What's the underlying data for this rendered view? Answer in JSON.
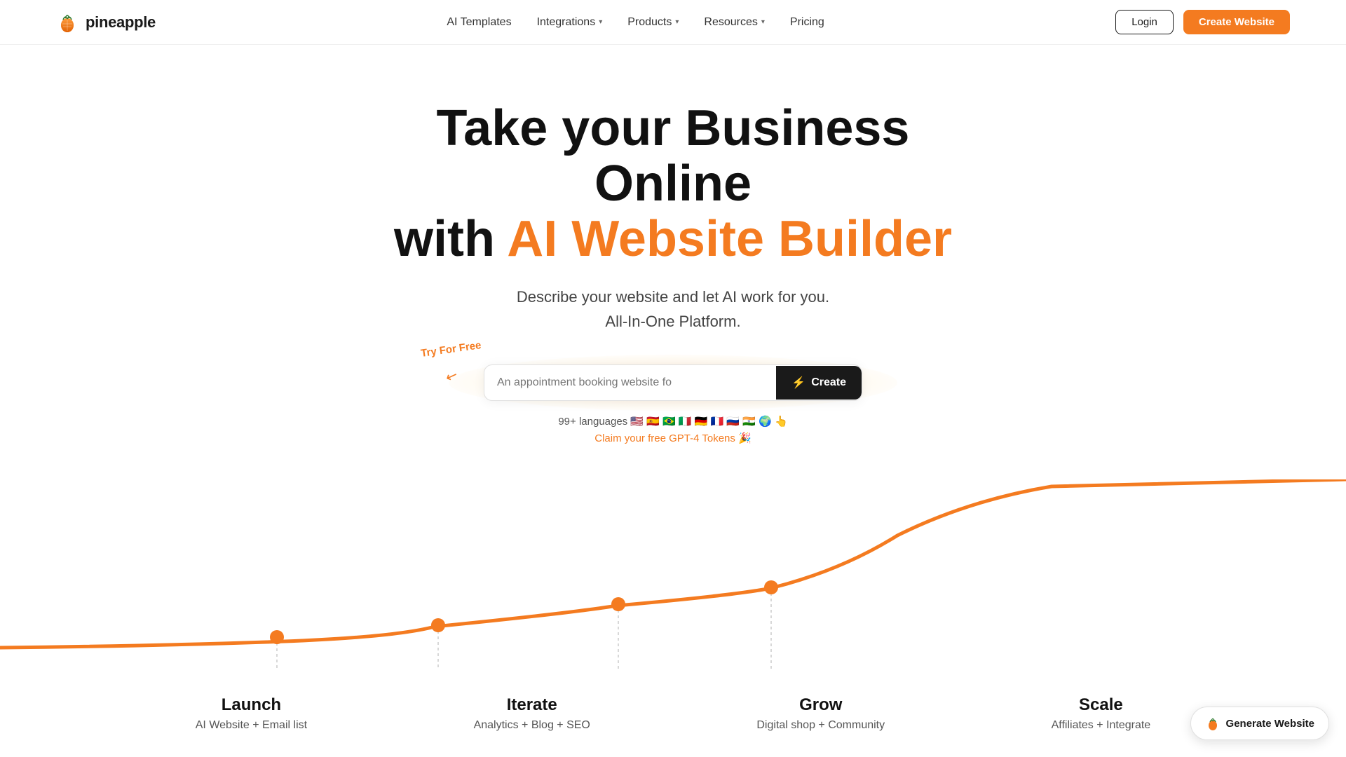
{
  "brand": {
    "name": "pineapple",
    "logo_alt": "Pineapple logo"
  },
  "nav": {
    "links": [
      {
        "label": "AI Templates",
        "has_dropdown": false
      },
      {
        "label": "Integrations",
        "has_dropdown": true
      },
      {
        "label": "Products",
        "has_dropdown": true
      },
      {
        "label": "Resources",
        "has_dropdown": true
      },
      {
        "label": "Pricing",
        "has_dropdown": false
      }
    ],
    "login_label": "Login",
    "create_label": "Create Website"
  },
  "hero": {
    "title_line1": "Take your Business Online",
    "title_line2_plain": "with ",
    "title_line2_accent": "AI Website Builder",
    "subtitle_line1": "Describe your website and let AI work for you.",
    "subtitle_line2": "All-In-One Platform.",
    "try_label": "Try For Free",
    "input_placeholder": "An appointment booking website fo",
    "create_button": "Create",
    "languages_text": "99+ languages 🇺🇸 🇪🇸 🇧🇷 🇮🇹 🇩🇪 🇫🇷 🇷🇺 🇮🇳 🌍 👆",
    "claim_link": "Claim your free GPT-4 Tokens 🎉"
  },
  "stages": [
    {
      "title": "Launch",
      "desc": "AI Website + Email list"
    },
    {
      "title": "Iterate",
      "desc": "Analytics + Blog + SEO"
    },
    {
      "title": "Grow",
      "desc": "Digital shop + Community"
    },
    {
      "title": "Scale",
      "desc": "Affiliates + Integrate"
    }
  ],
  "floating": {
    "label": "Generate Website"
  }
}
